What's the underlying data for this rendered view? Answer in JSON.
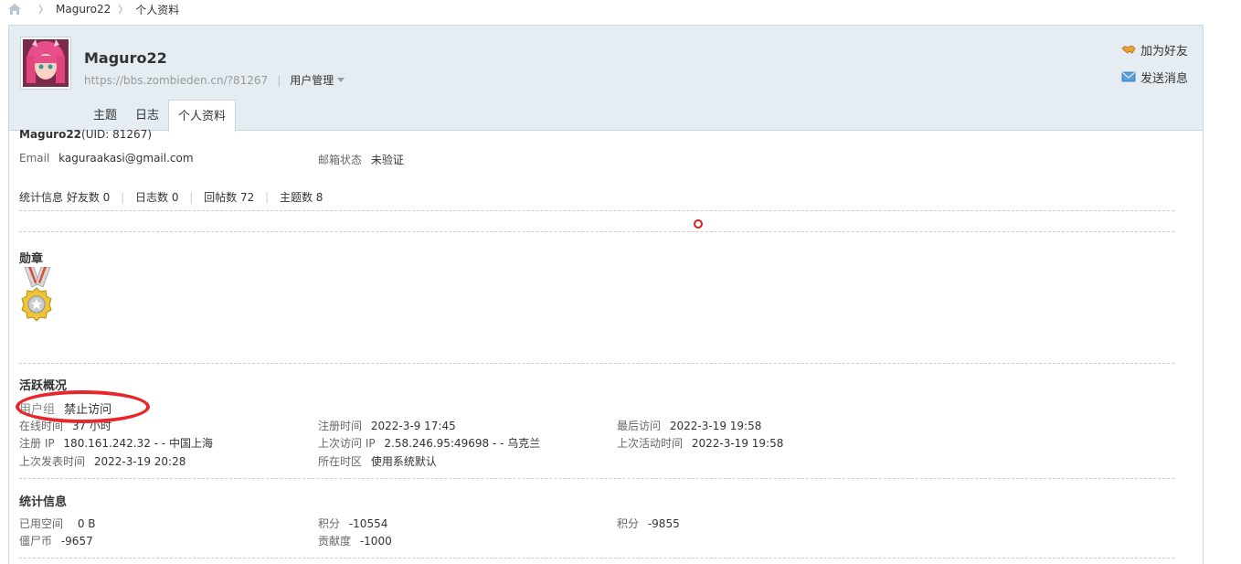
{
  "breadcrumb": {
    "user": "Maguro22",
    "page": "个人资料"
  },
  "header": {
    "username": "Maguro22",
    "url": "https://bbs.zombieden.cn/?81267",
    "manage_label": "用户管理"
  },
  "actions": {
    "add_friend": "加为好友",
    "send_message": "发送消息"
  },
  "tabs": [
    {
      "label": "主题"
    },
    {
      "label": "日志"
    },
    {
      "label": "个人资料"
    }
  ],
  "profile": {
    "name": "Maguro22",
    "uid": "(UID: 81267)",
    "email_label": "Email",
    "email": "kaguraakasi@gmail.com",
    "email_status_label": "邮箱状态",
    "email_status": "未验证",
    "stats_label": "统计信息",
    "friends": "好友数 0",
    "blogs": "日志数 0",
    "replies": "回帖数 72",
    "threads": "主题数 8"
  },
  "medals": {
    "title": "勋章"
  },
  "activity": {
    "title": "活跃概况",
    "group_label": "用户组",
    "group": "禁止访问",
    "online_label": "在线时间",
    "online": "37 小时",
    "reg_time_label": "注册时间",
    "reg_time": "2022-3-9 17:45",
    "last_visit_label": "最后访问",
    "last_visit": "2022-3-19 19:58",
    "reg_ip_label": "注册 IP",
    "reg_ip": "180.161.242.32 - - 中国上海",
    "last_ip_label": "上次访问 IP",
    "last_ip": "2.58.246.95:49698 - - 乌克兰",
    "last_active_label": "上次活动时间",
    "last_active": "2022-3-19 19:58",
    "last_post_label": "上次发表时间",
    "last_post": "2022-3-19 20:28",
    "tz_label": "所在时区",
    "tz": "使用系统默认"
  },
  "stats": {
    "title": "统计信息",
    "space_label": "已用空间",
    "space": "0 B",
    "credits_label": "积分",
    "credits": "-10554",
    "credits2_label": "积分",
    "credits2": "-9855",
    "zombie_label": "僵尸币",
    "zombie": "-9657",
    "contrib_label": "贡献度",
    "contrib": "-1000"
  },
  "colors": {
    "header_bg": "#e5edf2",
    "annotation_red": "#e8252a"
  }
}
